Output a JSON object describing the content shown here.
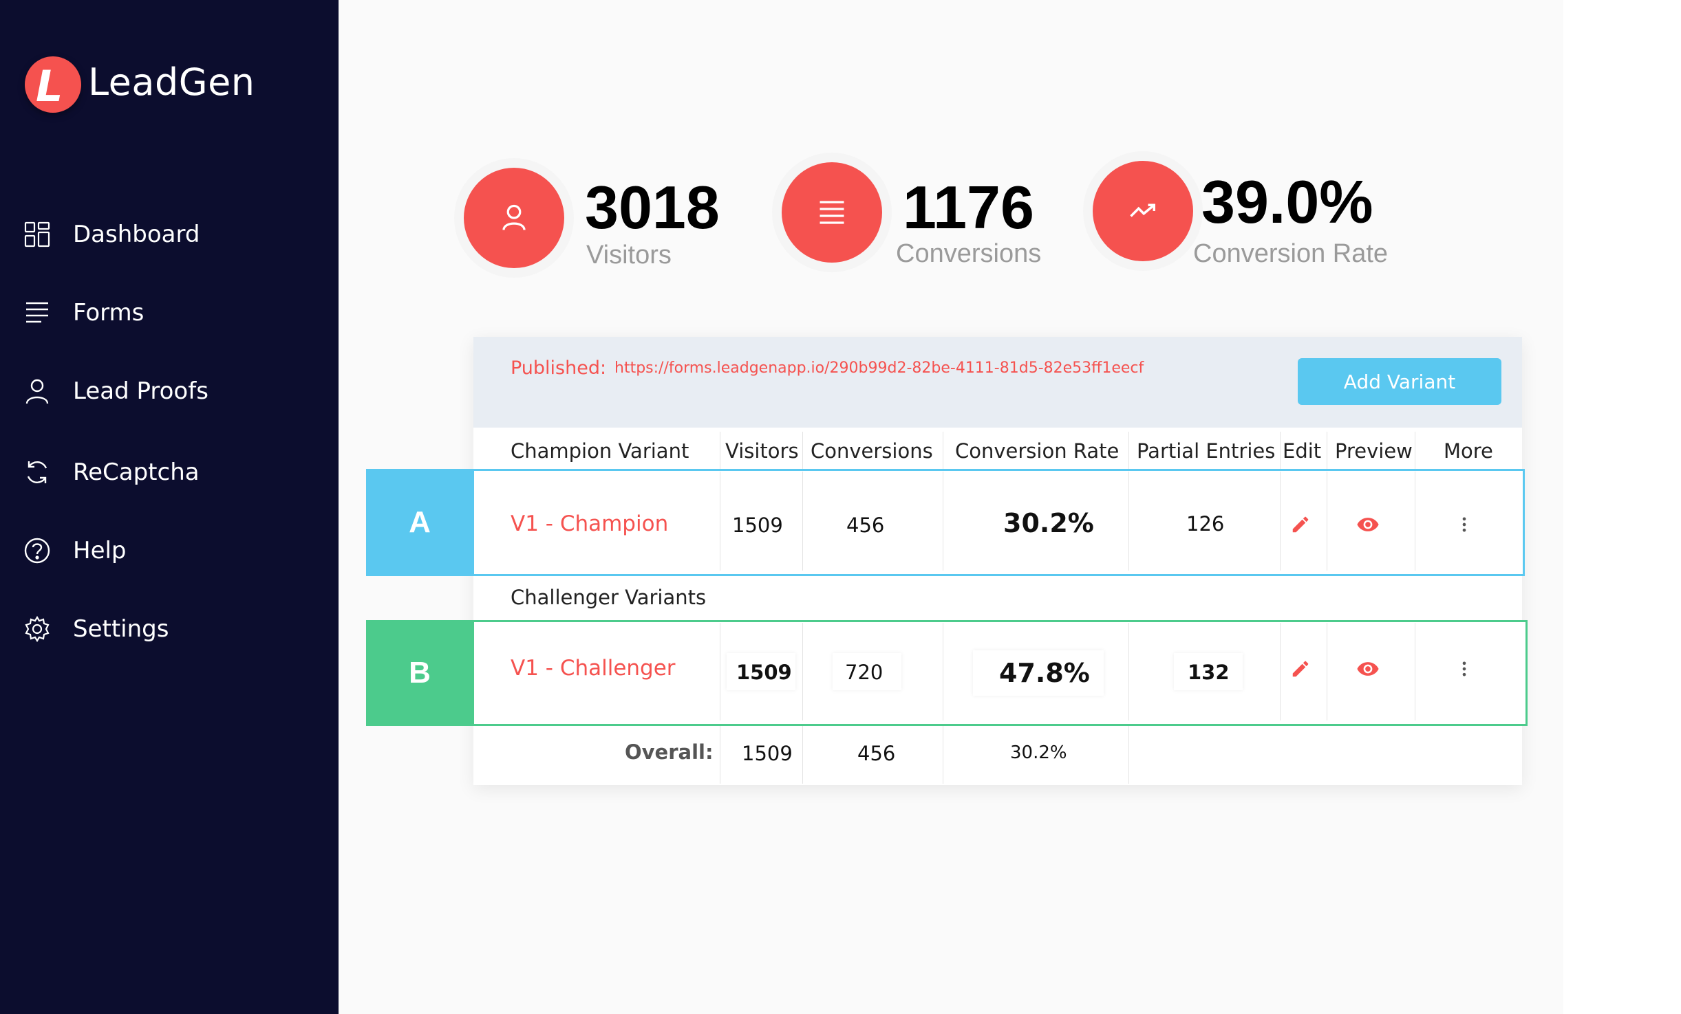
{
  "app": {
    "logo_letter": "L",
    "name": "LeadGen"
  },
  "sidebar": {
    "items": [
      {
        "label": "Dashboard",
        "icon": "dashboard-grid-icon"
      },
      {
        "label": "Forms",
        "icon": "list-lines-icon"
      },
      {
        "label": "Lead Proofs",
        "icon": "user-icon"
      },
      {
        "label": "ReCaptcha",
        "icon": "refresh-icon"
      },
      {
        "label": "Help",
        "icon": "question-circle-icon"
      },
      {
        "label": "Settings",
        "icon": "gear-icon"
      }
    ]
  },
  "stats": [
    {
      "value": "3018",
      "label": "Visitors",
      "icon": "user-icon"
    },
    {
      "value": "1176",
      "label": "Conversions",
      "icon": "list-lines-icon"
    },
    {
      "value": "39.0%",
      "label": "Conversion Rate",
      "icon": "trend-up-icon"
    }
  ],
  "published": {
    "label": "Published:",
    "url": "https://forms.leadgenapp.io/290b99d2-82be-4111-81d5-82e53ff1eecf"
  },
  "add_variant_label": "Add Variant",
  "table": {
    "headers": {
      "variant": "Champion Variant",
      "visitors": "Visitors",
      "conversions": "Conversions",
      "rate": "Conversion Rate",
      "partial": "Partial Entries",
      "edit": "Edit",
      "preview": "Preview",
      "more": "More"
    },
    "challenger_section_label": "Challenger Variants",
    "champion": {
      "tab": "A",
      "name": "V1 - Champion",
      "visitors": "1509",
      "conversions": "456",
      "rate": "30.2%",
      "partial": "126"
    },
    "challenger": {
      "tab": "B",
      "name": "V1 - Challenger",
      "visitors": "1509",
      "conversions": "720",
      "rate": "47.8%",
      "partial": "132"
    },
    "overall": {
      "label": "Overall:",
      "visitors": "1509",
      "conversions": "456",
      "rate": "30.2%"
    }
  },
  "colors": {
    "sidebar_bg": "#0c0d2e",
    "accent_red": "#f5524f",
    "champion_blue": "#5ac8f0",
    "challenger_green": "#4ccb8c"
  }
}
